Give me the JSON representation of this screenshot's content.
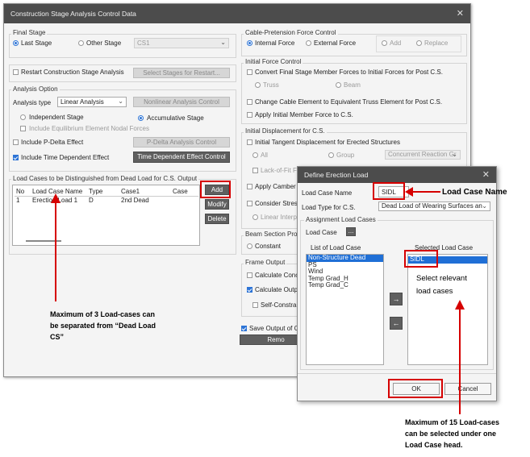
{
  "main_dialog": {
    "title": "Construction Stage Analysis Control Data",
    "final_stage": {
      "label": "Final Stage",
      "last_stage": "Last Stage",
      "other_stage": "Other Stage",
      "stage_select": "CS1"
    },
    "restart": {
      "label": "Restart Construction Stage Analysis",
      "button": "Select Stages for Restart..."
    },
    "analysis_option": {
      "label": "Analysis Option",
      "type_label": "Analysis type",
      "type_value": "Linear Analysis",
      "nonlinear_button": "Nonlinear Analysis Control",
      "independent_stage": "Independent Stage",
      "accumulative_stage": "Accumulative Stage",
      "include_equilibrium": "Include Equilibrium Element Nodal Forces",
      "include_pdelta": "Include P-Delta Effect",
      "pdelta_button": "P-Delta Analysis Control",
      "include_time_dependent": "Include Time Dependent Effect",
      "time_dependent_button": "Time Dependent Effect Control"
    },
    "load_cases": {
      "label": "Load Cases to be Distinguished from Dead Load for C.S. Output",
      "columns": [
        "No",
        "Load Case Name",
        "Type",
        "Case1",
        "Case"
      ],
      "rows": [
        [
          "1",
          "Erection Load 1",
          "D",
          "2nd Dead",
          ""
        ]
      ],
      "add_button": "Add",
      "modify_button": "Modify",
      "delete_button": "Delete"
    },
    "cable_pretension": {
      "label": "Cable-Pretension Force Control",
      "internal_force": "Internal Force",
      "external_force": "External Force",
      "add": "Add",
      "replace": "Replace"
    },
    "initial_force": {
      "label": "Initial Force Control",
      "convert": "Convert Final Stage Member Forces to Initial Forces for Post C.S.",
      "truss": "Truss",
      "beam": "Beam",
      "change_cable": "Change Cable Element to Equivalent Truss Element for Post C.S.",
      "apply_initial": "Apply Initial Member Force to C.S."
    },
    "initial_displacement": {
      "label": "Initial Displacement for C.S.",
      "initial_tangent": "Initial Tangent Displacement for Erected Structures",
      "all": "All",
      "group": "Group",
      "group_select": "Concurrent Reaction Gr",
      "lack_of_fit": "Lack-of-Fit Fo",
      "apply_camber": "Apply Camber D",
      "consider_stress": "Consider Stress",
      "linear_interp": "Linear Interpo"
    },
    "beam_section": {
      "label": "Beam Section Prop",
      "constant": "Constant"
    },
    "frame_output": {
      "label": "Frame Output",
      "calc_concu": "Calculate Concu",
      "calc_output": "Calculate Outpu",
      "self_constrain": "Self-Constrain"
    },
    "save_output": "Save Output of C",
    "remove_button": "Remo"
  },
  "erection_dialog": {
    "title": "Define Erection Load",
    "load_case_name_label": "Load Case Name",
    "load_case_name_value": "SIDL",
    "load_type_label": "Load Type for C.S.",
    "load_type_value": "Dead Load of Wearing Surfaces an",
    "assignment_label": "Assignment Load Cases",
    "load_case_label": "Load Case",
    "ellipsis": "...",
    "list_label": "List of Load Case",
    "selected_label": "Selected Load Case",
    "list_items": [
      "Non-Structure Dead",
      "PS",
      "Wind",
      "Temp Grad_H",
      "Temp Grad_C"
    ],
    "selected_items": [
      "SIDL"
    ],
    "move_right": "→",
    "move_left": "←",
    "ok_button": "OK",
    "cancel_button": "Cancel"
  },
  "annotations": {
    "load_case_name": "Load Case Name",
    "select_relevant": [
      "Select relevant",
      "load cases"
    ],
    "max_three": [
      "Maximum of 3 Load-cases can",
      "be separated from “Dead Load",
      "CS”"
    ],
    "max_fifteen": [
      "Maximum of 15 Load-cases",
      "can be selected under one",
      "Load Case head."
    ]
  },
  "colors": {
    "titlebar": "#4c4c4c",
    "accent": "#2d74d6",
    "highlight_red": "#d60000",
    "dark_button": "#5f5f5f"
  }
}
